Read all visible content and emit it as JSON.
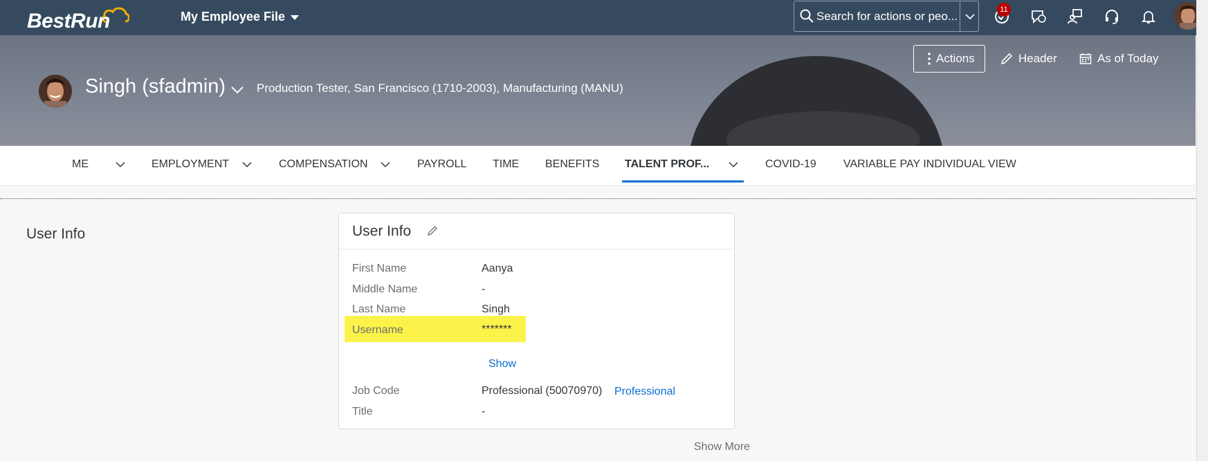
{
  "shell": {
    "logo_text": "BestRun",
    "app_menu_label": "My Employee File",
    "search_placeholder": "Search for actions or peo...",
    "notification_count": "11"
  },
  "header": {
    "actions_label": "Actions",
    "header_label": "Header",
    "as_of_label": "As of Today",
    "employee_name": "Singh (sfadmin)",
    "employee_subtitle": "Production Tester, San Francisco (1710-2003), Manufacturing (MANU)"
  },
  "tabs": [
    {
      "label": "ME"
    },
    {
      "label": "EMPLOYMENT"
    },
    {
      "label": "COMPENSATION"
    },
    {
      "label": "PAYROLL"
    },
    {
      "label": "TIME"
    },
    {
      "label": "BENEFITS"
    },
    {
      "label": "TALENT PROF..."
    },
    {
      "label": "COVID-19"
    },
    {
      "label": "VARIABLE PAY INDIVIDUAL VIEW"
    }
  ],
  "active_tab": "TALENT PROF...",
  "section": {
    "title": "User Info"
  },
  "card": {
    "title": "User Info",
    "fields": {
      "first_name": {
        "label": "First Name",
        "value": "Aanya"
      },
      "middle_name": {
        "label": "Middle Name",
        "value": "-"
      },
      "last_name": {
        "label": "Last Name",
        "value": "Singh"
      },
      "username": {
        "label": "Username",
        "value": "*******",
        "show_label": "Show"
      },
      "job_code": {
        "label": "Job Code",
        "value": "Professional (50070970)",
        "link": "Professional"
      },
      "title": {
        "label": "Title",
        "value": "-"
      }
    }
  },
  "show_more_label": "Show More",
  "colors": {
    "shell_bg": "#354a5f",
    "accent": "#0a6ed1",
    "highlight": "#fcf34a",
    "badge": "#bb0000"
  }
}
